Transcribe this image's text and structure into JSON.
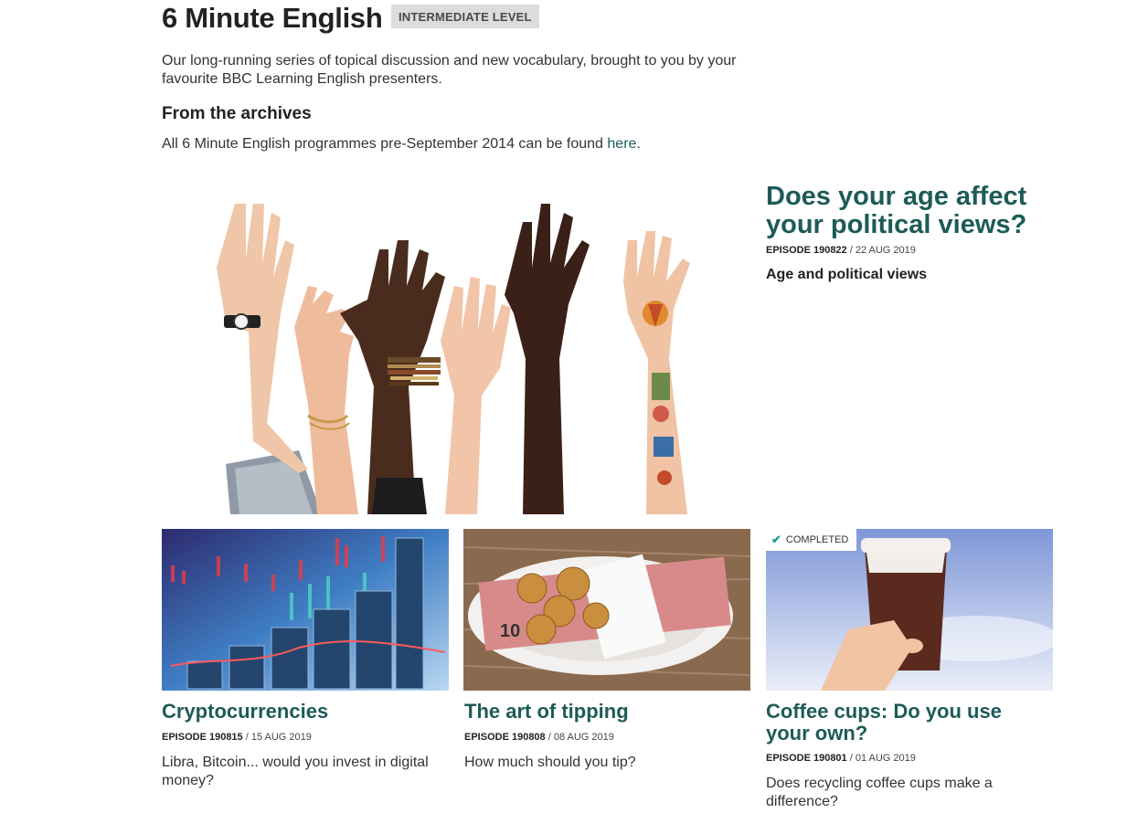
{
  "header": {
    "title": "6 Minute English",
    "level_badge": "INTERMEDIATE LEVEL",
    "intro": "Our long-running series of topical discussion and new vocabulary, brought to you by your favourite BBC Learning English presenters."
  },
  "archives": {
    "heading": "From the archives",
    "text_before": "All 6 Minute English programmes pre-September 2014 can be found ",
    "link_label": "here",
    "text_after": "."
  },
  "featured": {
    "title": "Does your age affect your political views?",
    "episode_label": "EPISODE 190822",
    "date": " / 22 AUG 2019",
    "description": "Age and political views",
    "image_icon": "raised-hands-image"
  },
  "episodes": [
    {
      "title": "Cryptocurrencies",
      "episode_label": "EPISODE 190815",
      "date": " / 15 AUG 2019",
      "description": "Libra, Bitcoin... would you invest in digital money?",
      "image_icon": "coins-chart-image"
    },
    {
      "title": "The art of tipping",
      "episode_label": "EPISODE 190808",
      "date": " / 08 AUG 2019",
      "description": "How much should you tip?",
      "image_icon": "tip-plate-image"
    },
    {
      "title": "Coffee cups: Do you use your own?",
      "episode_label": "EPISODE 190801",
      "date": " / 01 AUG 2019",
      "description": "Does recycling coffee cups make a difference?",
      "image_icon": "coffee-cup-image",
      "status": "COMPLETED",
      "status_icon": "checkmark-icon"
    }
  ],
  "colors": {
    "accent": "#1d5b57",
    "badge_bg": "#dcdcdc",
    "completed_tick": "#2a9d8f"
  }
}
